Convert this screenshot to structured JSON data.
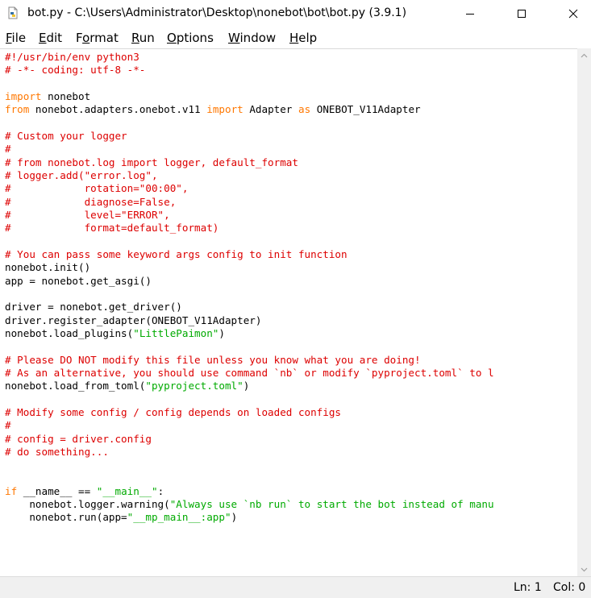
{
  "window": {
    "title": "bot.py - C:\\Users\\Administrator\\Desktop\\nonebot\\bot\\bot.py (3.9.1)"
  },
  "menu": [
    {
      "label": "File",
      "underline": "F",
      "rest": "ile"
    },
    {
      "label": "Edit",
      "underline": "E",
      "rest": "dit"
    },
    {
      "label": "Format",
      "pre": "F",
      "underline": "o",
      "rest": "rmat"
    },
    {
      "label": "Run",
      "underline": "R",
      "rest": "un"
    },
    {
      "label": "Options",
      "underline": "O",
      "rest": "ptions"
    },
    {
      "label": "Window",
      "underline": "W",
      "rest": "indow"
    },
    {
      "label": "Help",
      "underline": "H",
      "rest": "elp"
    }
  ],
  "code_lines": [
    [
      [
        "c",
        "#!/usr/bin/env python3"
      ]
    ],
    [
      [
        "c",
        "# -*- coding: utf-8 -*-"
      ]
    ],
    [],
    [
      [
        "k",
        "import"
      ],
      [
        "n",
        " nonebot"
      ]
    ],
    [
      [
        "k",
        "from"
      ],
      [
        "n",
        " nonebot.adapters.onebot.v11 "
      ],
      [
        "k",
        "import"
      ],
      [
        "n",
        " Adapter "
      ],
      [
        "k",
        "as"
      ],
      [
        "n",
        " ONEBOT_V11Adapter"
      ]
    ],
    [],
    [
      [
        "c",
        "# Custom your logger"
      ]
    ],
    [
      [
        "c",
        "#"
      ]
    ],
    [
      [
        "c",
        "# from nonebot.log import logger, default_format"
      ]
    ],
    [
      [
        "c",
        "# logger.add(\"error.log\","
      ]
    ],
    [
      [
        "c",
        "#            rotation=\"00:00\","
      ]
    ],
    [
      [
        "c",
        "#            diagnose=False,"
      ]
    ],
    [
      [
        "c",
        "#            level=\"ERROR\","
      ]
    ],
    [
      [
        "c",
        "#            format=default_format)"
      ]
    ],
    [],
    [
      [
        "c",
        "# You can pass some keyword args config to init function"
      ]
    ],
    [
      [
        "n",
        "nonebot.init()"
      ]
    ],
    [
      [
        "n",
        "app = nonebot.get_asgi()"
      ]
    ],
    [],
    [
      [
        "n",
        "driver = nonebot.get_driver()"
      ]
    ],
    [
      [
        "n",
        "driver.register_adapter(ONEBOT_V11Adapter)"
      ]
    ],
    [
      [
        "n",
        "nonebot.load_plugins("
      ],
      [
        "s",
        "\"LittlePaimon\""
      ],
      [
        "n",
        ")"
      ]
    ],
    [],
    [
      [
        "c",
        "# Please DO NOT modify this file unless you know what you are doing!"
      ]
    ],
    [
      [
        "c",
        "# As an alternative, you should use command `nb` or modify `pyproject.toml` to l"
      ]
    ],
    [
      [
        "n",
        "nonebot.load_from_toml("
      ],
      [
        "s",
        "\"pyproject.toml\""
      ],
      [
        "n",
        ")"
      ]
    ],
    [],
    [
      [
        "c",
        "# Modify some config / config depends on loaded configs"
      ]
    ],
    [
      [
        "c",
        "#"
      ]
    ],
    [
      [
        "c",
        "# config = driver.config"
      ]
    ],
    [
      [
        "c",
        "# do something..."
      ]
    ],
    [],
    [],
    [
      [
        "k",
        "if"
      ],
      [
        "n",
        " __name__ == "
      ],
      [
        "s",
        "\"__main__\""
      ],
      [
        "n",
        ":"
      ]
    ],
    [
      [
        "n",
        "    nonebot.logger.warning("
      ],
      [
        "s",
        "\"Always use `nb run` to start the bot instead of manu"
      ]
    ],
    [
      [
        "n",
        "    nonebot.run(app="
      ],
      [
        "s",
        "\"__mp_main__:app\""
      ],
      [
        "n",
        ")"
      ]
    ]
  ],
  "status": {
    "line": "Ln: 1",
    "col": "Col: 0"
  },
  "colors": {
    "keyword": "#ff7700",
    "comment": "#dd0000",
    "string": "#00aa00",
    "default": "#000000"
  },
  "icons": {
    "app": "python-file-icon",
    "minimize": "minimize-icon",
    "maximize": "maximize-icon",
    "close": "close-icon"
  }
}
